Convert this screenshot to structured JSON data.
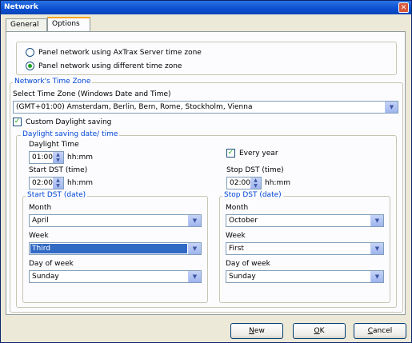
{
  "window": {
    "title": "Network",
    "close_glyph": "✕"
  },
  "tabs": [
    {
      "label": "General"
    },
    {
      "label": "Options"
    }
  ],
  "timezone_source": {
    "option_axtrax": "Panel network using AxTrax Server time zone",
    "option_different": "Panel network using different time zone",
    "selected": "option_different"
  },
  "network_tz": {
    "legend": "Network's Time Zone",
    "select_label": "Select Time Zone (Windows Date and Time)",
    "value": "(GMT+01:00) Amsterdam, Berlin, Bern, Rome, Stockholm, Vienna",
    "custom_dst_label": "Custom Daylight saving",
    "custom_dst_checked": true
  },
  "dst": {
    "legend": "Daylight saving date/ time",
    "daylight_time_label": "Daylight Time",
    "daylight_time_value": "01:00",
    "unit": "hh:mm",
    "every_year_label": "Every year",
    "every_year_checked": true,
    "start_time_label": "Start DST (time)",
    "start_time_value": "02:00",
    "stop_time_label": "Stop DST (time)",
    "stop_time_value": "02:00",
    "start_date": {
      "legend": "Start DST (date)",
      "month_label": "Month",
      "month": "April",
      "week_label": "Week",
      "week": "Third",
      "dow_label": "Day of week",
      "dow": "Sunday"
    },
    "stop_date": {
      "legend": "Stop DST (date)",
      "month_label": "Month",
      "month": "October",
      "week_label": "Week",
      "week": "First",
      "dow_label": "Day of week",
      "dow": "Sunday"
    }
  },
  "buttons": {
    "new_access": "N",
    "new_rest": "ew",
    "ok_access": "O",
    "ok_rest": "K",
    "cancel_access": "C",
    "cancel_rest": "ancel"
  },
  "icons": {
    "dropdown": "chevron-down-icon",
    "spin": "spin-arrows-icon"
  }
}
